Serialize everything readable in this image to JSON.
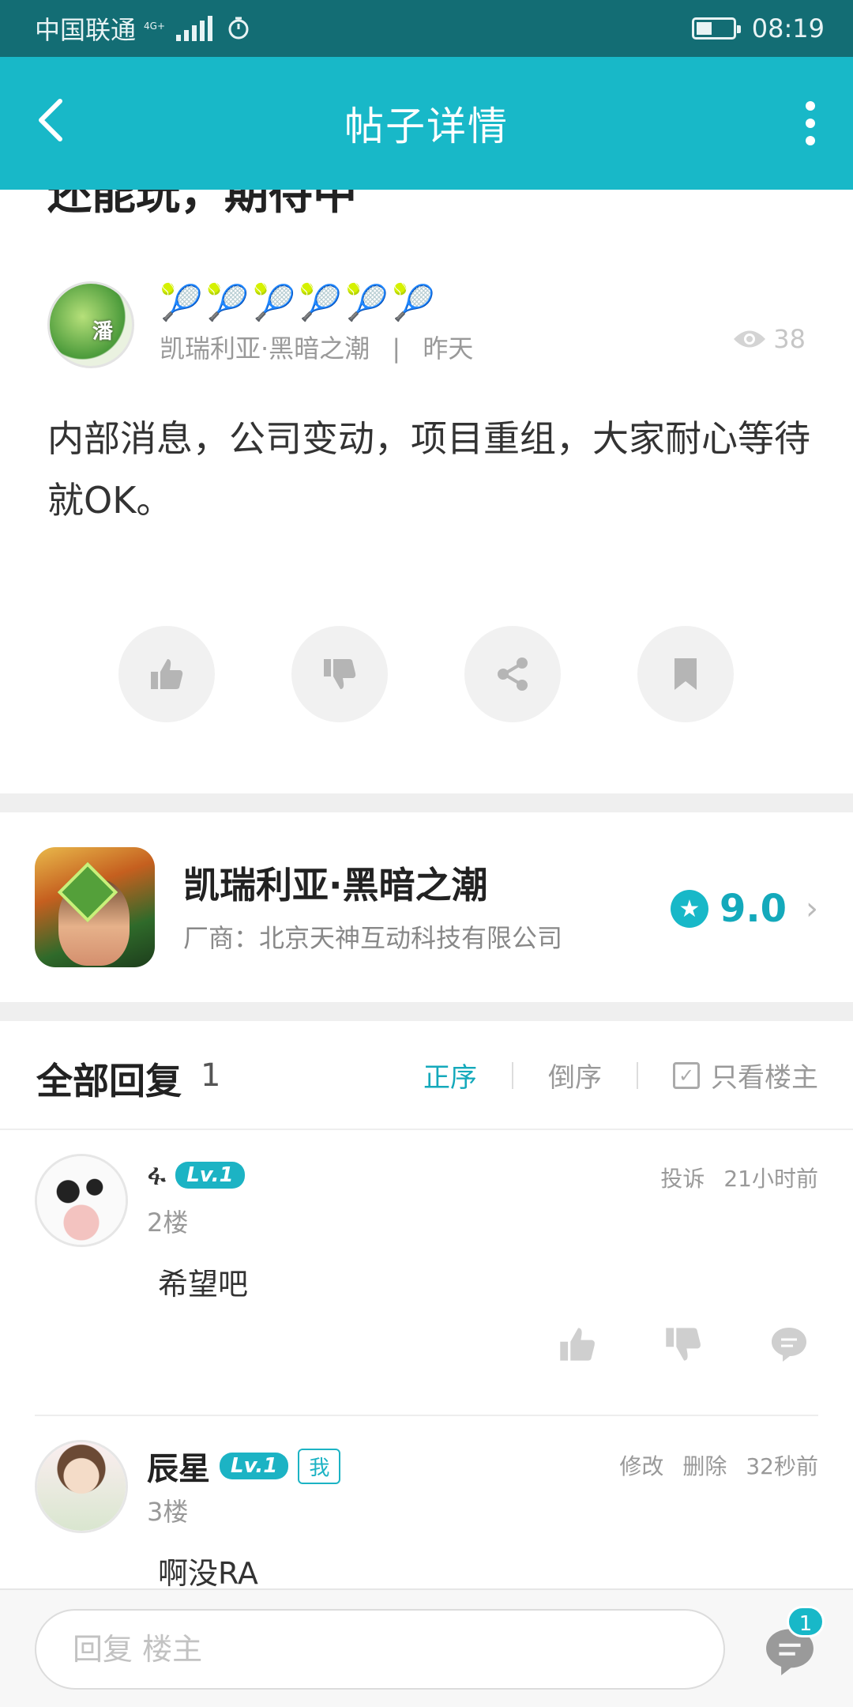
{
  "status_bar": {
    "carrier": "中国联通",
    "network": "4G+",
    "time": "08:19"
  },
  "app_bar": {
    "title": "帖子详情"
  },
  "post": {
    "title_partial": "还能玩，期待中",
    "author_badges": [
      "🎾",
      "🎾",
      "🎾",
      "🎾",
      "🎾",
      "🎾"
    ],
    "avatar_label": "潘",
    "game_tag": "凯瑞利亚·黑暗之潮",
    "meta_separator": "|",
    "time": "昨天",
    "views": "38",
    "body": "内部消息，公司变动，项目重组，大家耐心等待就OK。"
  },
  "game": {
    "name": "凯瑞利亚·黑暗之潮",
    "vendor": "厂商：北京天神互动科技有限公司",
    "rating": "9.0",
    "accent_color": "#18b8c8"
  },
  "replies": {
    "title": "全部回复",
    "count": "1",
    "sort_asc": "正序",
    "sort_desc": "倒序",
    "only_op": "只看楼主",
    "items": [
      {
        "username": "ፋ",
        "level": "Lv.1",
        "floor": "2楼",
        "content": "希望吧",
        "report": "投诉",
        "time": "21小时前"
      },
      {
        "username": "辰星",
        "level": "Lv.1",
        "me_badge": "我",
        "floor": "3楼",
        "content": "啊没RA",
        "edit": "修改",
        "delete": "删除",
        "time": "32秒前"
      }
    ]
  },
  "bottom_bar": {
    "placeholder": "回复  楼主",
    "badge_count": "1"
  }
}
